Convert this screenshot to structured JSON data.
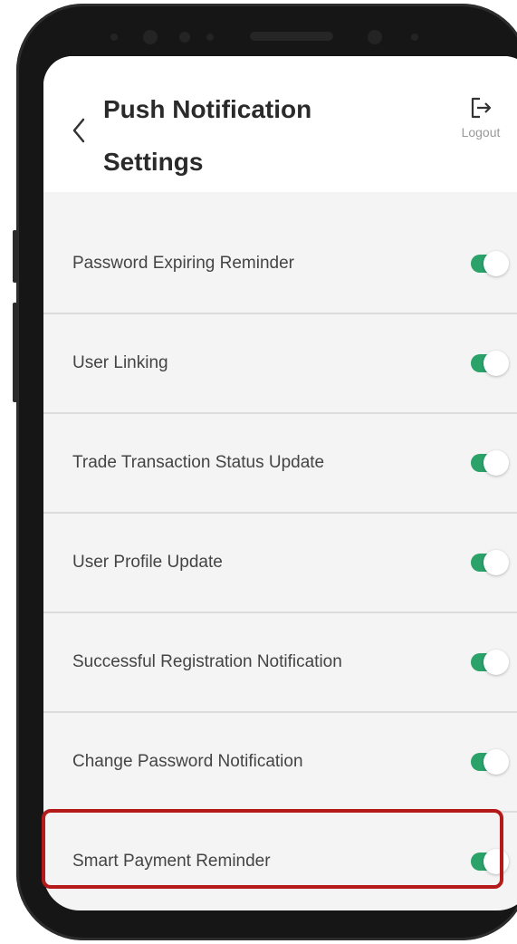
{
  "header": {
    "title_line1": "Push Notification",
    "title_line2": "Settings",
    "back_icon": "chevron-left-icon",
    "logout_label": "Logout",
    "logout_icon": "logout-icon"
  },
  "settings": [
    {
      "label": "Password Expiring Reminder",
      "enabled": true
    },
    {
      "label": "User Linking",
      "enabled": true
    },
    {
      "label": "Trade Transaction Status Update",
      "enabled": true
    },
    {
      "label": "User Profile Update",
      "enabled": true
    },
    {
      "label": "Successful Registration Notification",
      "enabled": true
    },
    {
      "label": "Change Password Notification",
      "enabled": true
    },
    {
      "label": "Smart Payment Reminder",
      "enabled": true
    }
  ],
  "highlighted_setting": "Smart Payment Reminder",
  "colors": {
    "toggle_on": "#2aa26a",
    "highlight": "#b51a1a",
    "title": "#2a2a2a"
  }
}
